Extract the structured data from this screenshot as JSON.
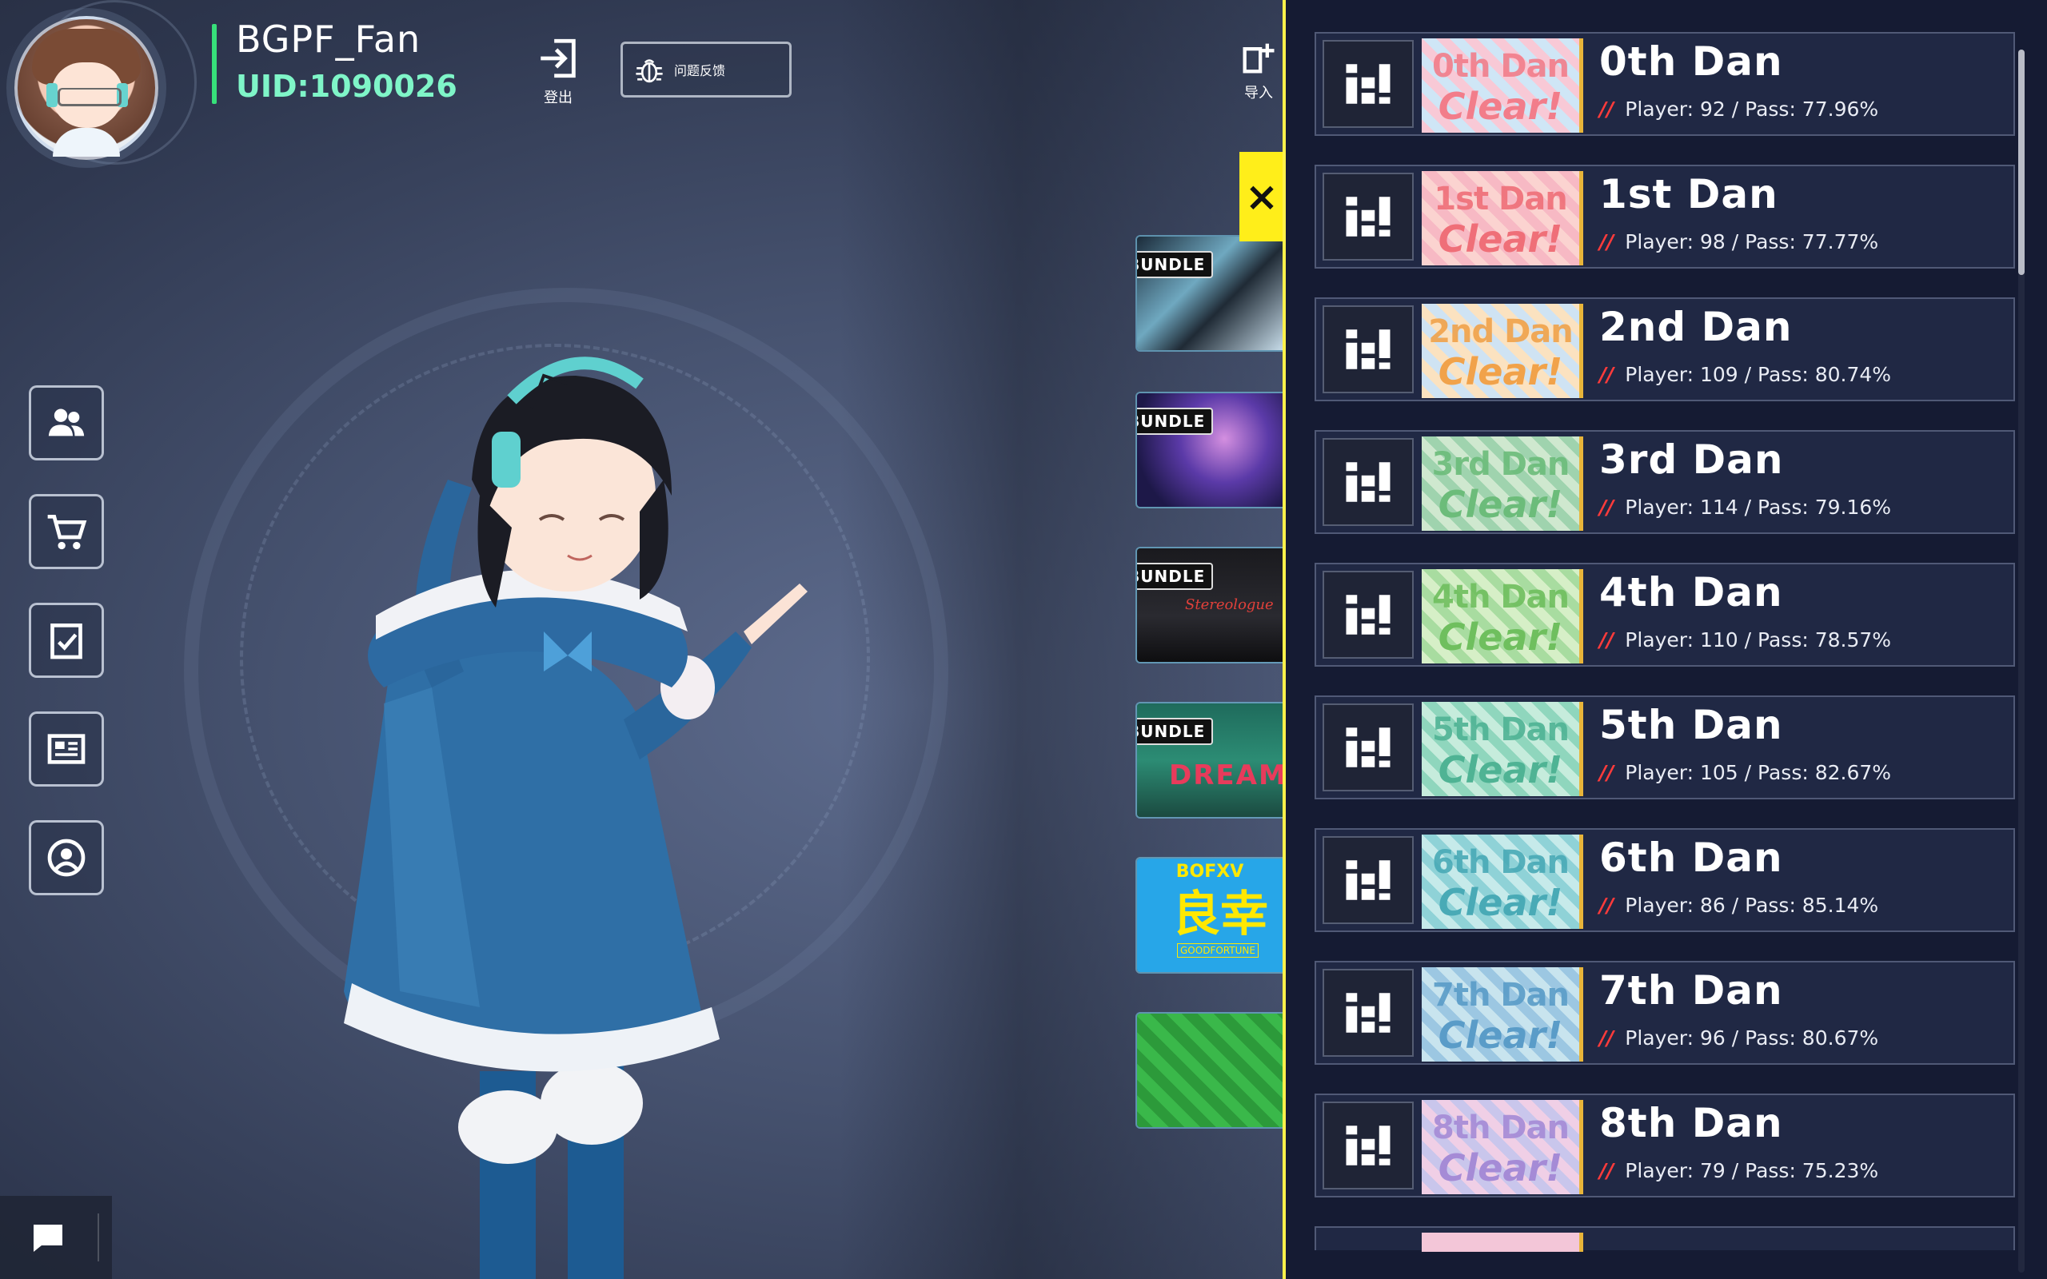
{
  "user": {
    "name": "BGPF_Fan",
    "uid": "UID:1090026"
  },
  "header": {
    "logout_label": "登出",
    "feedback_label": "问题反馈",
    "import_label": "导入"
  },
  "bundles": {
    "tag": "BUNDLE",
    "b3_text": "Stereologue",
    "b4_text": "DREAM",
    "b5_top": "BOFXV",
    "b5_main": "良幸",
    "b5_sub": "GOODFORTUNE"
  },
  "close_label": "×",
  "dans": [
    {
      "thumb_num": "0th Dan",
      "thumb_clear": "Clear!",
      "title": "0th Dan",
      "players": 92,
      "pass": "77.96%",
      "stats": "Player: 92 / Pass: 77.96%",
      "c1": "#f8c9d6",
      "c2": "#cfe6f6",
      "tc": "#f27d8a"
    },
    {
      "thumb_num": "1st Dan",
      "thumb_clear": "Clear!",
      "title": "1st Dan",
      "players": 98,
      "pass": "77.77%",
      "stats": "Player: 98 / Pass: 77.77%",
      "c1": "#fbd3d0",
      "c2": "#f7b9c4",
      "tc": "#ef6f78"
    },
    {
      "thumb_num": "2nd Dan",
      "thumb_clear": "Clear!",
      "title": "2nd Dan",
      "players": 109,
      "pass": "80.74%",
      "stats": "Player: 109 / Pass: 80.74%",
      "c1": "#fbe2c0",
      "c2": "#cfe3f3",
      "tc": "#f1a24a"
    },
    {
      "thumb_num": "3rd Dan",
      "thumb_clear": "Clear!",
      "title": "3rd Dan",
      "players": 114,
      "pass": "79.16%",
      "stats": "Player: 114 / Pass: 79.16%",
      "c1": "#cfe8cf",
      "c2": "#9fd3ae",
      "tc": "#6cbc7a"
    },
    {
      "thumb_num": "4th Dan",
      "thumb_clear": "Clear!",
      "title": "4th Dan",
      "players": 110,
      "pass": "78.57%",
      "stats": "Player: 110 / Pass: 78.57%",
      "c1": "#d6efc7",
      "c2": "#a8dca0",
      "tc": "#6fbf5e"
    },
    {
      "thumb_num": "5th Dan",
      "thumb_clear": "Clear!",
      "title": "5th Dan",
      "players": 105,
      "pass": "82.67%",
      "stats": "Player: 105 / Pass: 82.67%",
      "c1": "#c6ecdc",
      "c2": "#8fd6bd",
      "tc": "#4fb394"
    },
    {
      "thumb_num": "6th Dan",
      "thumb_clear": "Clear!",
      "title": "6th Dan",
      "players": 86,
      "pass": "85.14%",
      "stats": "Player: 86 / Pass: 85.14%",
      "c1": "#c6eaea",
      "c2": "#8fd2d7",
      "tc": "#49aab6"
    },
    {
      "thumb_num": "7th Dan",
      "thumb_clear": "Clear!",
      "title": "7th Dan",
      "players": 96,
      "pass": "80.67%",
      "stats": "Player: 96 / Pass: 80.67%",
      "c1": "#c8e4ee",
      "c2": "#9cc7e2",
      "tc": "#5a9cc8"
    },
    {
      "thumb_num": "8th Dan",
      "thumb_clear": "Clear!",
      "title": "8th Dan",
      "players": 79,
      "pass": "75.23%",
      "stats": "Player: 79 / Pass: 75.23%",
      "c1": "#f0cfe6",
      "c2": "#c9c6ec",
      "tc": "#a58bd6"
    }
  ],
  "side_menu": [
    {
      "name": "friends-icon"
    },
    {
      "name": "shop-cart-icon"
    },
    {
      "name": "task-check-icon"
    },
    {
      "name": "news-icon"
    },
    {
      "name": "profile-icon"
    }
  ],
  "colors": {
    "accent_yellow": "#fff14a",
    "uid_green": "#7ff5c8",
    "panel_bg": "#151b33",
    "slash_red": "#ff3b3b"
  }
}
